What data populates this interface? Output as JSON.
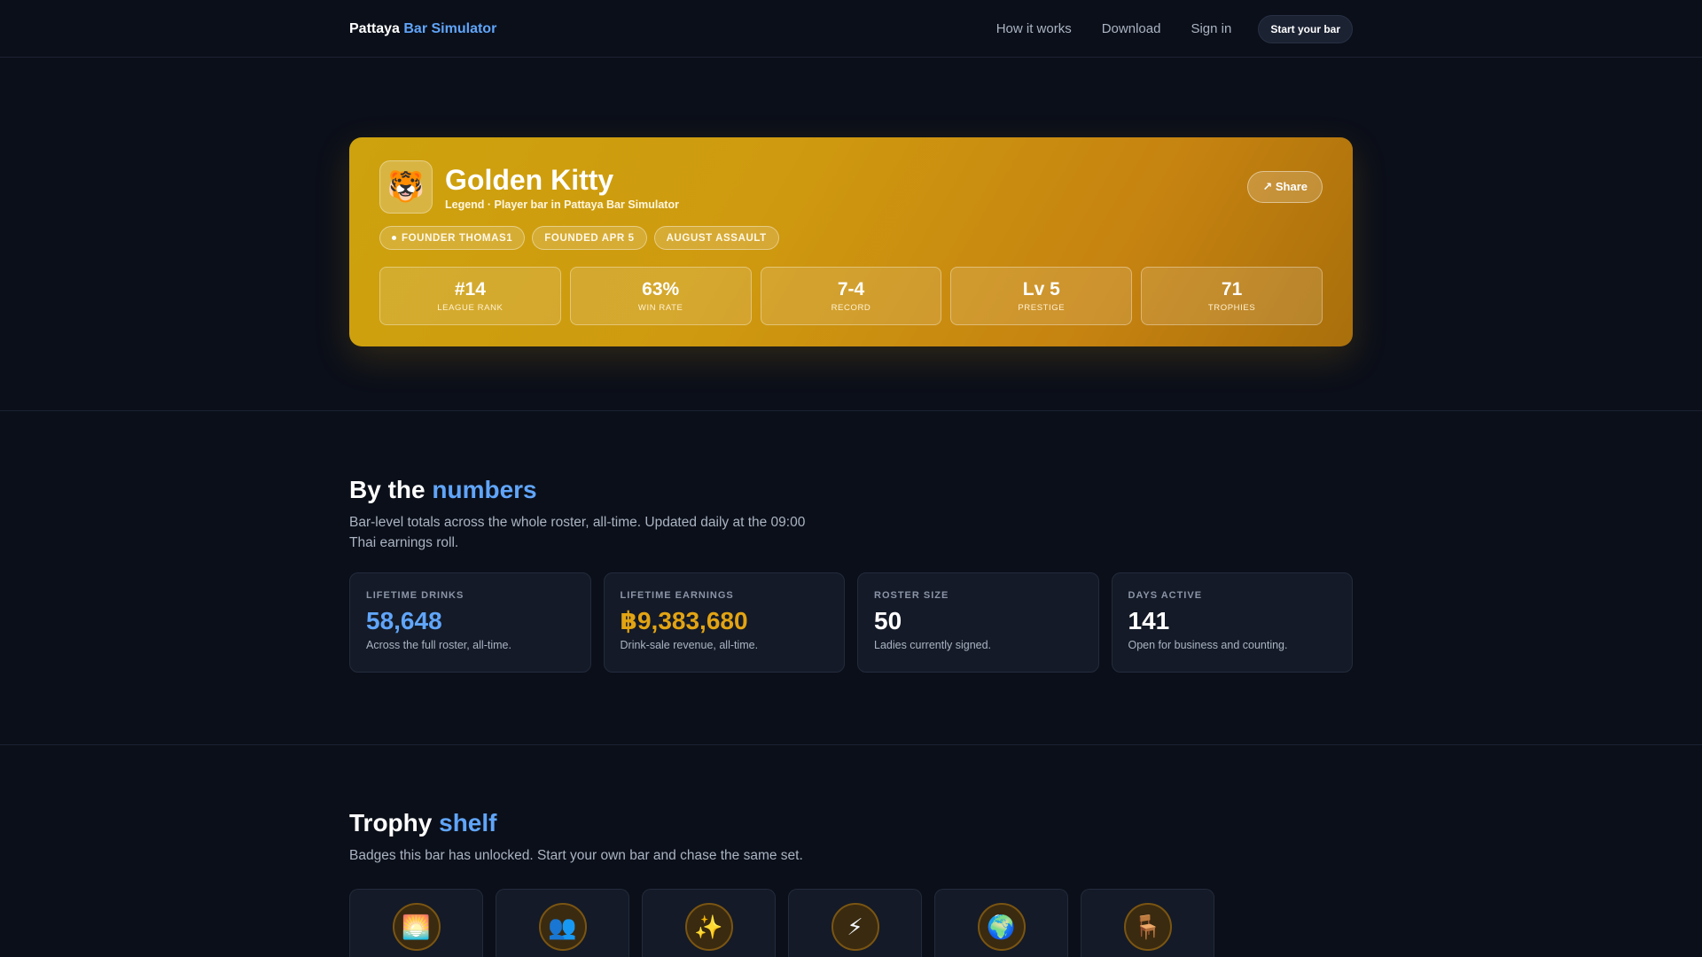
{
  "nav": {
    "brand_main": "Pattaya",
    "brand_accent": "Bar Simulator",
    "links": [
      "How it works",
      "Download",
      "Sign in"
    ],
    "cta": "Start your bar"
  },
  "hero": {
    "avatar_emoji": "🐯",
    "name": "Golden Kitty",
    "subtitle": "Legend · Player bar in Pattaya Bar Simulator",
    "share_label": "↗ Share",
    "tags": [
      "FOUNDER THOMAS1",
      "FOUNDED APR 5",
      "AUGUST ASSAULT"
    ],
    "stats": [
      {
        "value": "#14",
        "label": "LEAGUE RANK"
      },
      {
        "value": "63%",
        "label": "WIN RATE"
      },
      {
        "value": "7-4",
        "label": "RECORD"
      },
      {
        "value": "Lv 5",
        "label": "PRESTIGE"
      },
      {
        "value": "71",
        "label": "TROPHIES"
      }
    ]
  },
  "numbers": {
    "title_main": "By the",
    "title_accent": "numbers",
    "description": "Bar-level totals across the whole roster, all-time. Updated daily at the 09:00 Thai earnings roll.",
    "cards": [
      {
        "label": "LIFETIME DRINKS",
        "value": "58,648",
        "note": "Across the full roster, all-time.",
        "color": "#60a5fa"
      },
      {
        "label": "LIFETIME EARNINGS",
        "value": "฿9,383,680",
        "note": "Drink-sale revenue, all-time.",
        "color": "#e2a413"
      },
      {
        "label": "ROSTER SIZE",
        "value": "50",
        "note": "Ladies currently signed.",
        "color": "#ffffff"
      },
      {
        "label": "DAYS ACTIVE",
        "value": "141",
        "note": "Open for business and counting.",
        "color": "#ffffff"
      }
    ]
  },
  "trophies": {
    "title_main": "Trophy",
    "title_accent": "shelf",
    "description": "Badges this bar has unlocked. Start your own bar and chase the same set.",
    "items": [
      {
        "icon": "🌅",
        "name": "sunrise-icon"
      },
      {
        "icon": "👥",
        "name": "people-icon"
      },
      {
        "icon": "✨",
        "name": "sparkles-icon"
      },
      {
        "icon": "⚡",
        "name": "lightning-icon"
      },
      {
        "icon": "🌍",
        "name": "globe-icon"
      },
      {
        "icon": "🪑",
        "name": "chair-icon"
      }
    ]
  },
  "colors": {
    "background": "#0b0f19",
    "accent": "#60a5fa",
    "gold": "#cf9a0f"
  }
}
